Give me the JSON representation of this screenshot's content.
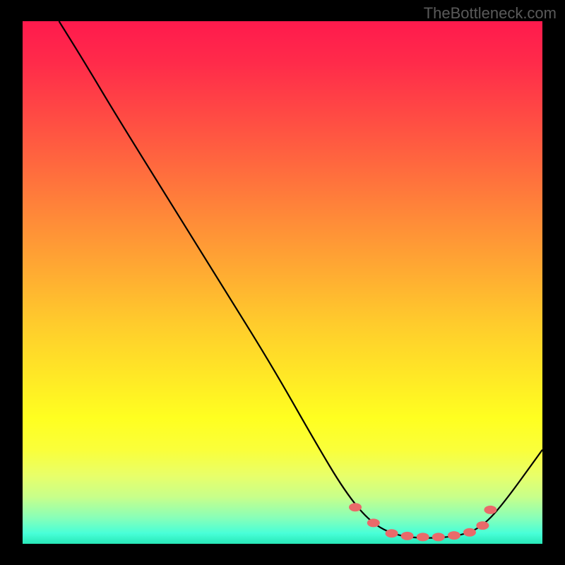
{
  "watermark": "TheBottleneck.com",
  "chart_data": {
    "type": "line",
    "title": "",
    "xlabel": "",
    "ylabel": "",
    "xlim": [
      0,
      100
    ],
    "ylim": [
      0,
      100
    ],
    "curve": [
      {
        "x": 7,
        "y": 100
      },
      {
        "x": 12,
        "y": 92
      },
      {
        "x": 18,
        "y": 82
      },
      {
        "x": 28,
        "y": 66
      },
      {
        "x": 38,
        "y": 50
      },
      {
        "x": 48,
        "y": 34
      },
      {
        "x": 56,
        "y": 20
      },
      {
        "x": 62,
        "y": 10
      },
      {
        "x": 67,
        "y": 4
      },
      {
        "x": 72,
        "y": 1.5
      },
      {
        "x": 78,
        "y": 1
      },
      {
        "x": 84,
        "y": 1.5
      },
      {
        "x": 88,
        "y": 3
      },
      {
        "x": 92,
        "y": 7
      },
      {
        "x": 100,
        "y": 18
      }
    ],
    "markers": [
      {
        "x": 64,
        "y": 7
      },
      {
        "x": 67.5,
        "y": 4
      },
      {
        "x": 71,
        "y": 2
      },
      {
        "x": 74,
        "y": 1.5
      },
      {
        "x": 77,
        "y": 1.3
      },
      {
        "x": 80,
        "y": 1.3
      },
      {
        "x": 83,
        "y": 1.6
      },
      {
        "x": 86,
        "y": 2.2
      },
      {
        "x": 88.5,
        "y": 3.5
      },
      {
        "x": 90,
        "y": 6.5
      }
    ],
    "gradient_note": "Background gradient encodes value: red (high/bad) at top through yellow to green (low/good) at bottom"
  }
}
